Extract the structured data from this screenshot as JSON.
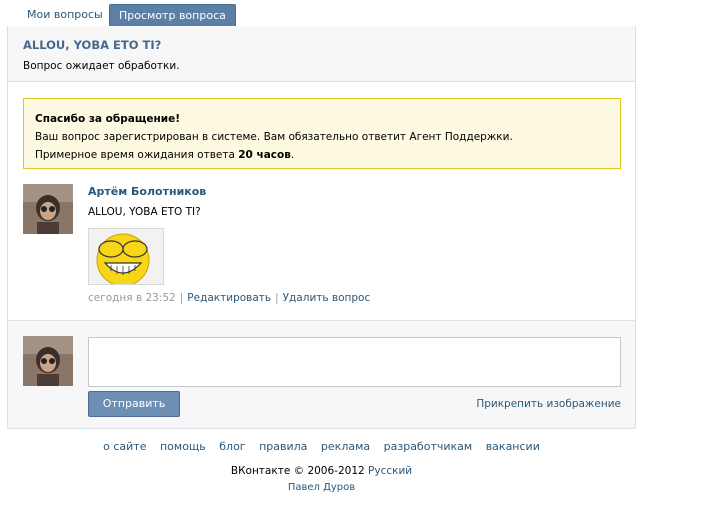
{
  "tabs": [
    {
      "label": "Мои вопросы",
      "active": false
    },
    {
      "label": "Просмотр вопроса",
      "active": true
    }
  ],
  "question": {
    "title": "ALLOU, YOBA ETO TI?",
    "status": "Вопрос ожидает обработки."
  },
  "notice": {
    "title": "Спасибо за обращение!",
    "line1": "Ваш вопрос зарегистрирован в системе. Вам обязательно ответит Агент Поддержки.",
    "line2_prefix": "Примерное время ожидания ответа",
    "line2_time": "20 часов",
    "line2_suffix": "."
  },
  "message": {
    "author": "Артём Болотников",
    "text": "ALLOU, YOBA ETO TI?",
    "image_icon": "smiley-covering-eyes-image",
    "time": "сегодня в 23:52",
    "edit_label": "Редактировать",
    "delete_label": "Удалить вопрос"
  },
  "reply": {
    "placeholder": "",
    "send_label": "Отправить",
    "attach_label": "Прикрепить изображение"
  },
  "footer": {
    "links": [
      "о сайте",
      "помощь",
      "блог",
      "правила",
      "реклама",
      "разработчикам",
      "вакансии"
    ],
    "copyright": "ВКонтакте © 2006-2012",
    "language": "Русский",
    "author": "Павел Дуров"
  },
  "colors": {
    "link": "#2b587a",
    "tab_active": "#5b7fa6",
    "notice_bg": "#fefae2",
    "notice_border": "#e2c822",
    "button": "#6d8fb3"
  }
}
